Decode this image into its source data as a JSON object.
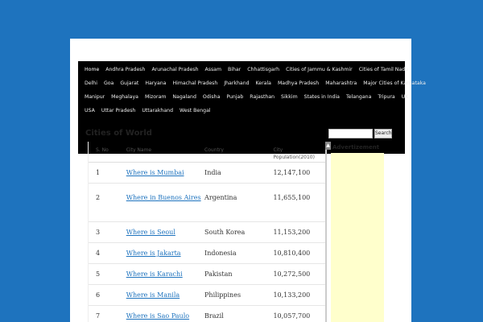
{
  "nav": {
    "rows": [
      [
        "Home",
        "Andhra Pradesh",
        "Arunachal Pradesh",
        "Assam",
        "Bihar",
        "Chhattisgarh",
        "Cities of Jammu & Kashmir",
        "Cities of Tamil Nadu"
      ],
      [
        "Delhi",
        "Goa",
        "Gujarat",
        "Haryana",
        "Himachal Pradesh",
        "Jharkhand",
        "Kerala",
        "Madhya Pradesh",
        "Maharashtra",
        "Major Cities of Karnataka"
      ],
      [
        "Manipur",
        "Meghalaya",
        "Mizoram",
        "Nagaland",
        "Odisha",
        "Punjab",
        "Rajasthan",
        "Sikkim",
        "States in India",
        "Telangana",
        "Tripura",
        "UK"
      ],
      [
        "USA",
        "Uttar Pradesh",
        "Uttarakhand",
        "West Bengal"
      ]
    ]
  },
  "page_title": "Cities of World",
  "table": {
    "headers": [
      "S. No",
      "City Name",
      "Country",
      "City Population(2010)"
    ],
    "rows": [
      {
        "no": "1",
        "city": "Where is Mumbai",
        "country": "India",
        "population": "12,147,100"
      },
      {
        "no": "2",
        "city": "Where in Buenos Aires",
        "country": "Argentina",
        "population": "11,655,100"
      },
      {
        "no": "3",
        "city": "Where is Seoul",
        "country": "South Korea",
        "population": "11,153,200"
      },
      {
        "no": "4",
        "city": "Where is Jakarta",
        "country": "Indonesia",
        "population": "10,810,400"
      },
      {
        "no": "5",
        "city": "Where is Karachi",
        "country": "Pakistan",
        "population": "10,272,500"
      },
      {
        "no": "6",
        "city": "Where is Manila",
        "country": "Philippines",
        "population": "10,133,200"
      },
      {
        "no": "7",
        "city": "Where is Sao Paulo",
        "country": "Brazil",
        "population": "10,057,700"
      }
    ]
  },
  "search": {
    "button_label": "Search",
    "placeholder": ""
  },
  "sidebar": {
    "ad_label": "Advertizement"
  },
  "colors": {
    "background": "#1e73be",
    "nav_bg": "#000000",
    "ad_bg": "#ffffcc",
    "link": "#1e73be"
  }
}
